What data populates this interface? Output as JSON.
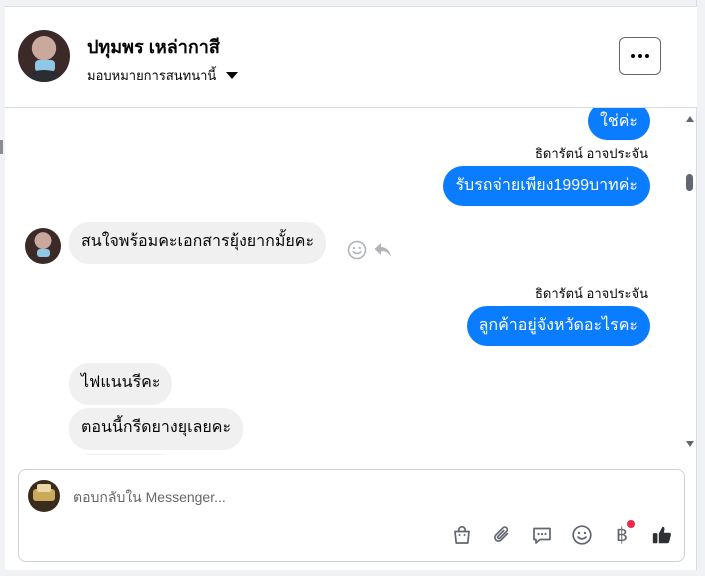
{
  "header": {
    "contact_name": "ปทุมพร เหล่ากาสี",
    "assign_label": "มอบหมายการสนทนานี้"
  },
  "messages": {
    "m1": {
      "text": "ใช่ค่ะ"
    },
    "m2": {
      "sender": "ธิดารัตน์ อาจประจัน",
      "text": "รับรถจ่ายเพียง1999บาทค่ะ"
    },
    "m3": {
      "text": "สนใจพร้อมคะเอกสารยุ้งยากมั้ยคะ"
    },
    "m4": {
      "sender": "ธิดารัตน์ อาจประจัน",
      "text": "ลูกค้าอยู่จังหวัดอะไรคะ"
    },
    "m5": {
      "text": "ไฟแนนรีคะ"
    },
    "m6": {
      "text": "ตอนนี้กรีดยางยุเลยคะ"
    }
  },
  "composer": {
    "placeholder": "ตอบกลับใน Messenger..."
  },
  "colors": {
    "outgoing_bubble": "#0a7cff",
    "incoming_bubble": "#f0f0f0",
    "icon_gray": "#606770",
    "notification_dot": "#f02849"
  },
  "icons": {
    "toolbar": [
      "shopping-bag-icon",
      "paperclip-icon",
      "saved-reply-icon",
      "emoji-icon",
      "baht-payment-icon",
      "thumbs-up-icon"
    ]
  }
}
